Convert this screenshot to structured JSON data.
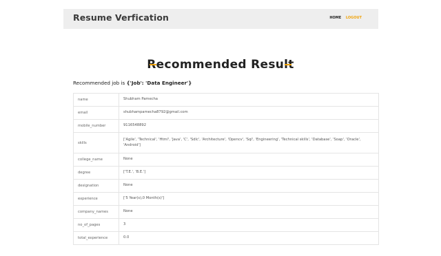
{
  "navbar": {
    "brand": "Resume Verfication",
    "links": {
      "home": "HOME",
      "logout": "LOGOUT"
    }
  },
  "page": {
    "title": "Recommended Result",
    "recommended_prefix": "Recommended job is ",
    "recommended_value": "{'Job': 'Data Engineer'}"
  },
  "colors": {
    "accent": "#f0a30a",
    "navbar_bg": "#eeeeee"
  },
  "rows": [
    {
      "key": "name",
      "value": "Shubham Pamecha"
    },
    {
      "key": "email",
      "value": "shubhampamecha8792@gmail.com"
    },
    {
      "key": "mobile_number",
      "value": "9116548892"
    },
    {
      "key": "skills",
      "value": "['Agile', 'Technical', 'Html', 'Java', 'C', 'Sdlc', 'Architecture', 'Opencv', 'Sql', 'Engineering', 'Technical skills', 'Database', 'Soap', 'Oracle', 'Android']"
    },
    {
      "key": "college_name",
      "value": "None"
    },
    {
      "key": "degree",
      "value": "['T.E.', 'B.E.']"
    },
    {
      "key": "designation",
      "value": "None"
    },
    {
      "key": "experience",
      "value": "['5 Year(s),0 Month(s)']"
    },
    {
      "key": "company_names",
      "value": "None"
    },
    {
      "key": "no_of_pages",
      "value": "3"
    },
    {
      "key": "total_experience",
      "value": "0.0"
    }
  ]
}
